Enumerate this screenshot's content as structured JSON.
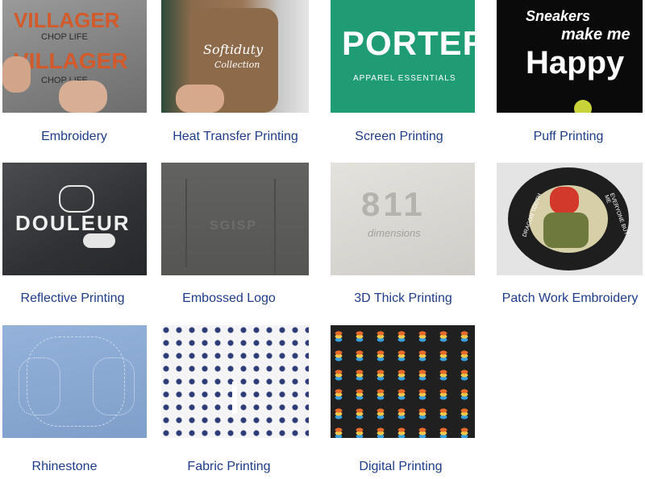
{
  "items": [
    {
      "label": "Embroidery",
      "lines": [
        "VILLAGER",
        "CHOP LIFE",
        "VILLAGER",
        "CHOP LIFE"
      ]
    },
    {
      "label": "Heat Transfer Printing",
      "lines": [
        "Softiduty",
        "Collection"
      ]
    },
    {
      "label": "Screen Printing",
      "lines": [
        "PORTER",
        "APPAREL ESSENTIALS"
      ]
    },
    {
      "label": "Puff Printing",
      "lines": [
        "Sneakers",
        "make me",
        "Happy"
      ]
    },
    {
      "label": "Reflective Printing",
      "lines": [
        "DOULEUR"
      ]
    },
    {
      "label": "Embossed Logo",
      "lines": [
        "SGISP"
      ]
    },
    {
      "label": "3D Thick Printing",
      "lines": [
        "811",
        "dimensions"
      ]
    },
    {
      "label": "Patch Work Embroidery",
      "lines": [
        "DRAGON TOOTH",
        "EVERYONE BUT ME"
      ]
    },
    {
      "label": "Rhinestone",
      "lines": []
    },
    {
      "label": "Fabric Printing",
      "lines": []
    },
    {
      "label": "Digital Printing",
      "lines": []
    }
  ]
}
